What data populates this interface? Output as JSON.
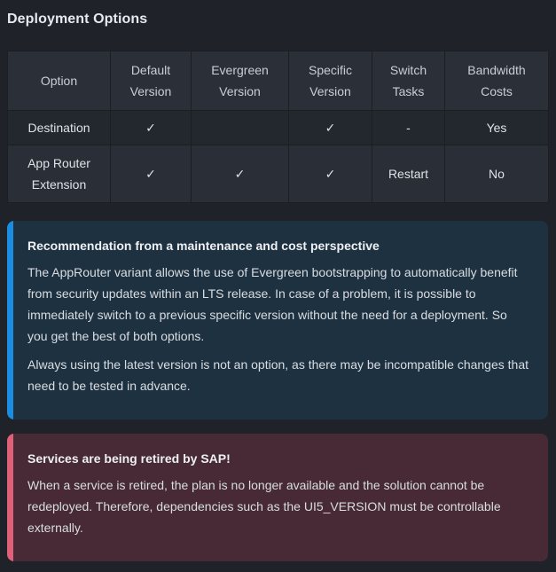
{
  "section": {
    "title": "Deployment Options"
  },
  "table": {
    "headers": [
      "Option",
      "Default Version",
      "Evergreen Version",
      "Specific Version",
      "Switch Tasks",
      "Bandwidth Costs"
    ],
    "rows": [
      [
        "Destination",
        "✓",
        "",
        "✓",
        "-",
        "Yes"
      ],
      [
        "App Router Extension",
        "✓",
        "✓",
        "✓",
        "Restart",
        "No"
      ]
    ]
  },
  "info_callout": {
    "title": "Recommendation from a maintenance and cost perspective",
    "paragraph1": "The AppRouter variant allows the use of Evergreen bootstrapping to automatically benefit from security updates within an LTS release. In case of a problem, it is possible to immediately switch to a previous specific version without the need for a deployment. So you get the best of both options.",
    "paragraph2": "Always using the latest version is not an option, as there may be incompatible changes that need to be tested in advance.",
    "accent_color": "#1a8de0"
  },
  "warning_callout": {
    "title": "Services are being retired by SAP!",
    "paragraph1": "When a service is retired, the plan is no longer available and the solution cannot be redeployed. Therefore, dependencies such as the UI5_VERSION must be controllable externally.",
    "accent_color": "#e0607a"
  },
  "colors": {
    "background": "#1f2329",
    "info_background": "#1e3140",
    "warning_background": "#472a35"
  }
}
